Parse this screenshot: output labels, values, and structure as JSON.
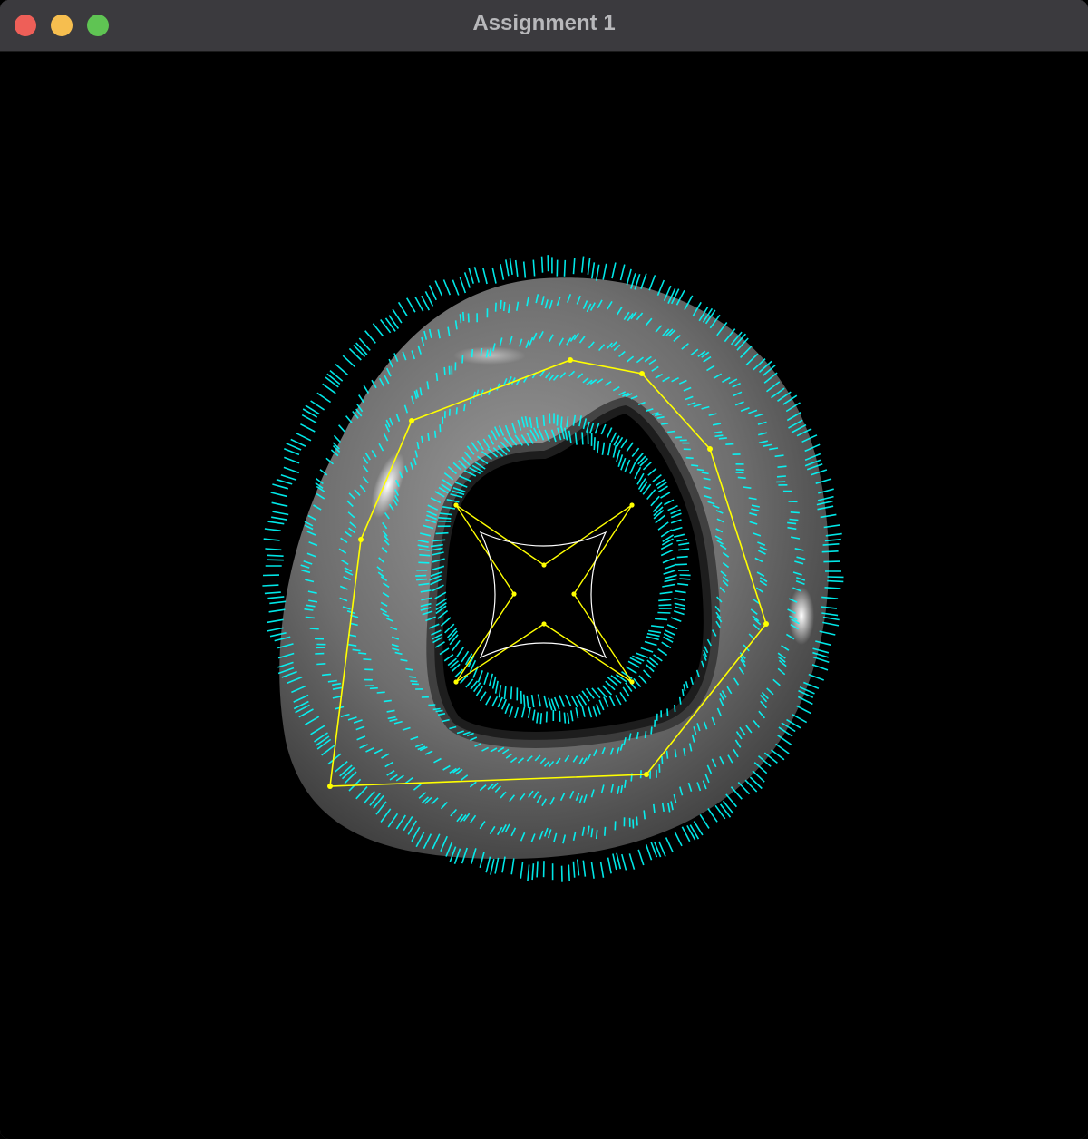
{
  "window": {
    "title": "Assignment 1",
    "controls": [
      "close",
      "minimize",
      "maximize"
    ]
  },
  "scene": {
    "background": "#000000",
    "surface_color": "#8a8a8a",
    "normals_color": "#00ffff",
    "control_polygon_color": "#ffff00",
    "profile_curve_color": "#ffffff"
  }
}
